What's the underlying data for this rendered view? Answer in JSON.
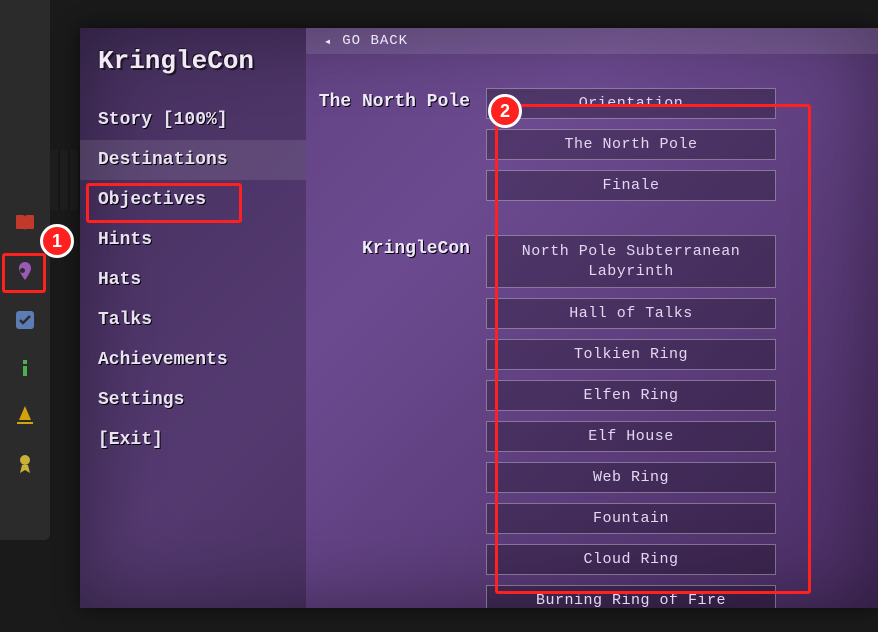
{
  "brand": "KringleCon",
  "topbar": {
    "label": "GO BACK",
    "arrow": "◂"
  },
  "sidebar": {
    "items": [
      {
        "label": "Story [100%]"
      },
      {
        "label": "Destinations",
        "active": true
      },
      {
        "label": "Objectives"
      },
      {
        "label": "Hints"
      },
      {
        "label": "Hats"
      },
      {
        "label": "Talks"
      },
      {
        "label": "Achievements"
      },
      {
        "label": "Settings"
      },
      {
        "label": "[Exit]"
      }
    ]
  },
  "toolbar": {
    "icons": [
      {
        "name": "book-icon"
      },
      {
        "name": "pin-icon",
        "highlighted": true
      },
      {
        "name": "check-icon"
      },
      {
        "name": "info-icon"
      },
      {
        "name": "wizard-icon"
      },
      {
        "name": "award-icon"
      }
    ]
  },
  "dest_groups": [
    {
      "label": "The North Pole",
      "items": [
        "Orientation",
        "The North Pole",
        "Finale"
      ]
    },
    {
      "label": "KringleCon",
      "items": [
        "North Pole Subterranean Labyrinth",
        "Hall of Talks",
        "Tolkien Ring",
        "Elfen Ring",
        "Elf House",
        "Web Ring",
        "Fountain",
        "Cloud Ring",
        "Burning Ring of Fire"
      ]
    }
  ],
  "annotations": {
    "marker1": "1",
    "marker2": "2",
    "highlight_color": "#ff2020"
  }
}
